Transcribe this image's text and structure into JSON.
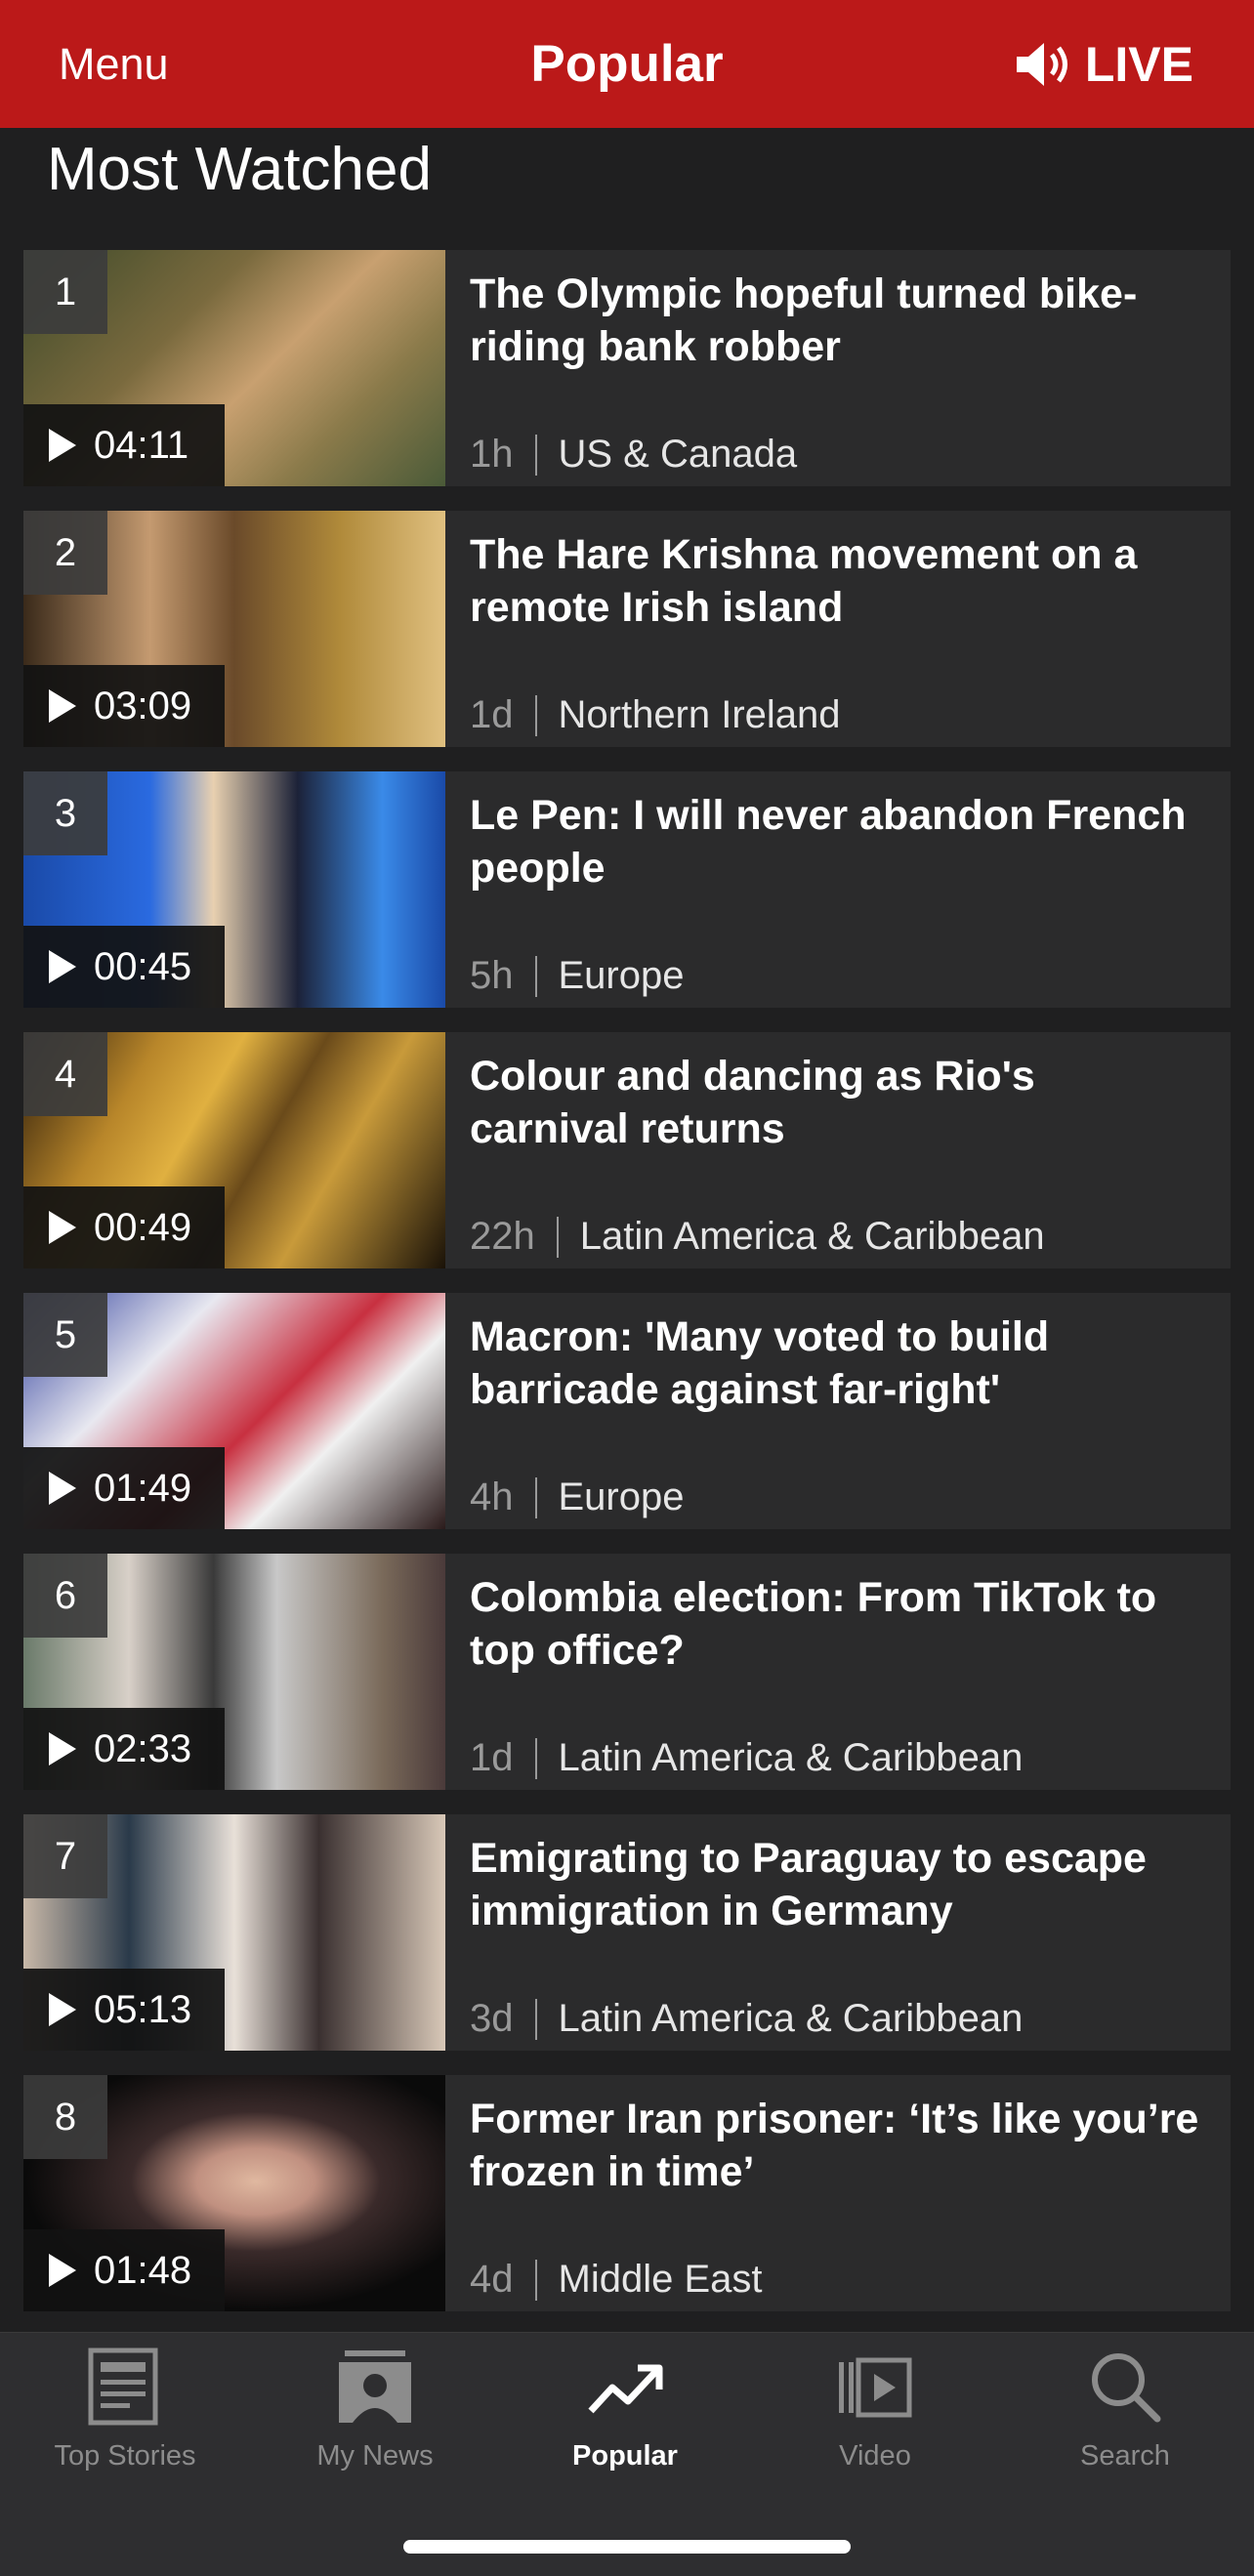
{
  "header": {
    "menu_label": "Menu",
    "title": "Popular",
    "live_label": "LIVE"
  },
  "section_title": "Most Watched",
  "items": [
    {
      "rank": "1",
      "duration": "04:11",
      "title": "The Olympic hopeful turned bike-riding bank robber",
      "age": "1h",
      "category": "US & Canada"
    },
    {
      "rank": "2",
      "duration": "03:09",
      "title": "The Hare Krishna movement on a remote Irish island",
      "age": "1d",
      "category": "Northern Ireland"
    },
    {
      "rank": "3",
      "duration": "00:45",
      "title": "Le Pen: I will never abandon French people",
      "age": "5h",
      "category": "Europe"
    },
    {
      "rank": "4",
      "duration": "00:49",
      "title": "Colour and dancing as Rio's carnival returns",
      "age": "22h",
      "category": "Latin America & Caribbean"
    },
    {
      "rank": "5",
      "duration": "01:49",
      "title": "Macron: 'Many voted to build barricade against far-right'",
      "age": "4h",
      "category": "Europe"
    },
    {
      "rank": "6",
      "duration": "02:33",
      "title": "Colombia election: From TikTok to top office?",
      "age": "1d",
      "category": "Latin America & Caribbean"
    },
    {
      "rank": "7",
      "duration": "05:13",
      "title": "Emigrating to Paraguay to escape immigration in Germany",
      "age": "3d",
      "category": "Latin America & Caribbean"
    },
    {
      "rank": "8",
      "duration": "01:48",
      "title": "Former Iran prisoner: ‘It’s like you’re frozen in time’",
      "age": "4d",
      "category": "Middle East"
    }
  ],
  "tabs": [
    {
      "label": "Top Stories",
      "icon": "newspaper-icon"
    },
    {
      "label": "My News",
      "icon": "person-icon"
    },
    {
      "label": "Popular",
      "icon": "trending-icon",
      "active": true
    },
    {
      "label": "Video",
      "icon": "video-icon"
    },
    {
      "label": "Search",
      "icon": "search-icon"
    }
  ],
  "colors": {
    "header_bg": "#bb1919",
    "background": "#1f1f20",
    "card_bg": "#2b2b2c",
    "tabbar_bg": "#2e2e30"
  }
}
